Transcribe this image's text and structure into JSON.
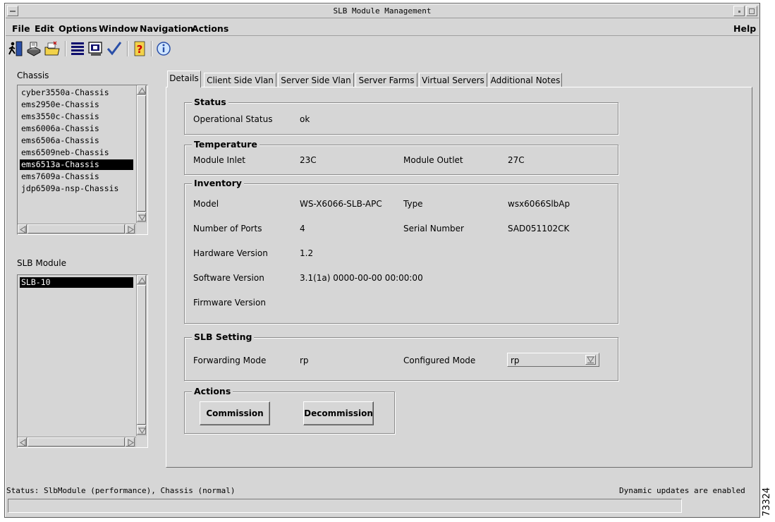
{
  "window": {
    "title": "SLB Module Management"
  },
  "menu": {
    "file": "File",
    "edit": "Edit",
    "options": "Options",
    "window": "Window",
    "navigation": "Navigation",
    "actions": "Actions",
    "help": "Help"
  },
  "chassis": {
    "label": "Chassis",
    "items": [
      "cyber3550a-Chassis",
      "ems2950e-Chassis",
      "ems3550c-Chassis",
      "ems6006a-Chassis",
      "ems6506a-Chassis",
      "ems6509neb-Chassis",
      "ems6513a-Chassis",
      "ems7609a-Chassis",
      "jdp6509a-nsp-Chassis"
    ],
    "selected_index": 6
  },
  "slb_module": {
    "label": "SLB Module",
    "items": [
      "SLB-10"
    ],
    "selected_index": 0
  },
  "tabs": [
    "Details",
    "Client Side Vlan",
    "Server Side Vlan",
    "Server Farms",
    "Virtual Servers",
    "Additional Notes"
  ],
  "details": {
    "status": {
      "title": "Status",
      "operational_status_label": "Operational Status",
      "operational_status_value": "ok"
    },
    "temperature": {
      "title": "Temperature",
      "module_inlet_label": "Module Inlet",
      "module_inlet_value": "23C",
      "module_outlet_label": "Module Outlet",
      "module_outlet_value": "27C"
    },
    "inventory": {
      "title": "Inventory",
      "model_label": "Model",
      "model_value": "WS-X6066-SLB-APC",
      "type_label": "Type",
      "type_value": "wsx6066SlbAp",
      "ports_label": "Number of Ports",
      "ports_value": "4",
      "serial_label": "Serial Number",
      "serial_value": "SAD051102CK",
      "hardware_label": "Hardware Version",
      "hardware_value": "1.2",
      "software_label": "Software Version",
      "software_value": "3.1(1a) 0000-00-00 00:00:00",
      "firmware_label": "Firmware Version",
      "firmware_value": ""
    },
    "slb_setting": {
      "title": "SLB Setting",
      "forwarding_label": "Forwarding Mode",
      "forwarding_value": "rp",
      "configured_label": "Configured Mode",
      "configured_value": "rp"
    },
    "actions": {
      "title": "Actions",
      "commission": "Commission",
      "decommission": "Decommission"
    }
  },
  "status": {
    "left": "Status: SlbModule (performance), Chassis (normal)",
    "right": "Dynamic updates are enabled"
  },
  "figure_id": "73324"
}
